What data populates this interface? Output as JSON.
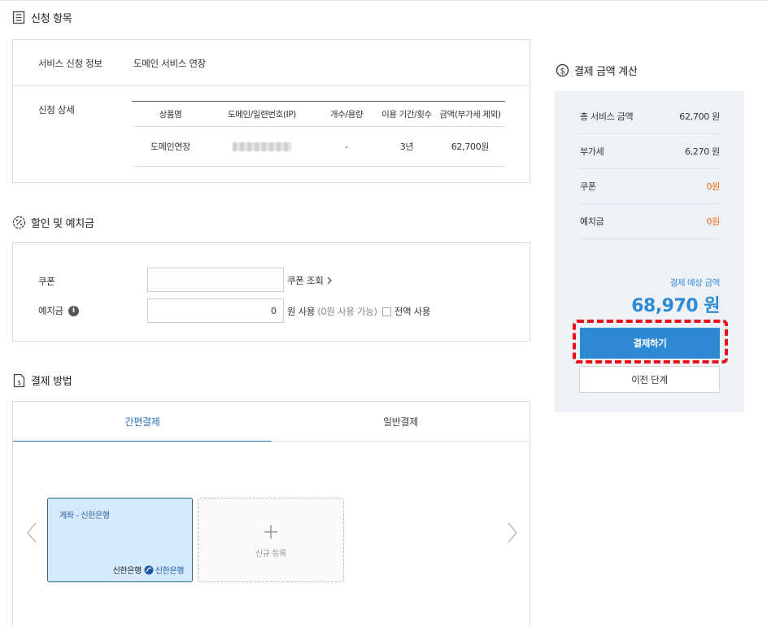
{
  "section1": {
    "title": "신청 항목",
    "service_label": "서비스 신청 정보",
    "service_value": "도메인 서비스 연장",
    "detail_label": "신청 상세",
    "table": {
      "headers": [
        "상품명",
        "도메인/일련번호(IP)",
        "개수/용량",
        "이용 기간/횟수",
        "금액(부가세 제외)"
      ],
      "rows": [
        {
          "product": "도메인연장",
          "domain": "",
          "qty": "-",
          "period": "3년",
          "amount": "62,700원"
        }
      ]
    }
  },
  "section2": {
    "title": "할인 및 예치금",
    "coupon_label": "쿠폰",
    "coupon_value": "",
    "coupon_lookup": "쿠폰 조회",
    "deposit_label": "예치금",
    "deposit_value": "0",
    "deposit_unit": "원 사용",
    "deposit_hint": "(0원 사용 가능)",
    "use_all_label": "전액 사용"
  },
  "section3": {
    "title": "결제 방법",
    "tabs": [
      "간편결제",
      "일반결제"
    ],
    "active_tab": 0,
    "card_title": "계좌 - 신한은행",
    "card_bank": "신한은행",
    "card_logo_text": "신한은행",
    "add_label": "신규 등록"
  },
  "summary": {
    "title": "결제 금액 계산",
    "rows": [
      {
        "label": "총 서비스 금액",
        "value": "62,700 원"
      },
      {
        "label": "부가세",
        "value": "6,270 원"
      },
      {
        "label": "쿠폰",
        "value": "0원"
      },
      {
        "label": "예치금",
        "value": "0원"
      }
    ],
    "expected_label": "결제 예상 금액",
    "expected_amount": "68,970 원",
    "pay_button": "결제하기",
    "prev_button": "이전 단계"
  },
  "colors": {
    "accent": "#2f8ad6",
    "highlight": "#e8101a",
    "orange": "#ef6a0f",
    "panel": "#eef2f7"
  }
}
